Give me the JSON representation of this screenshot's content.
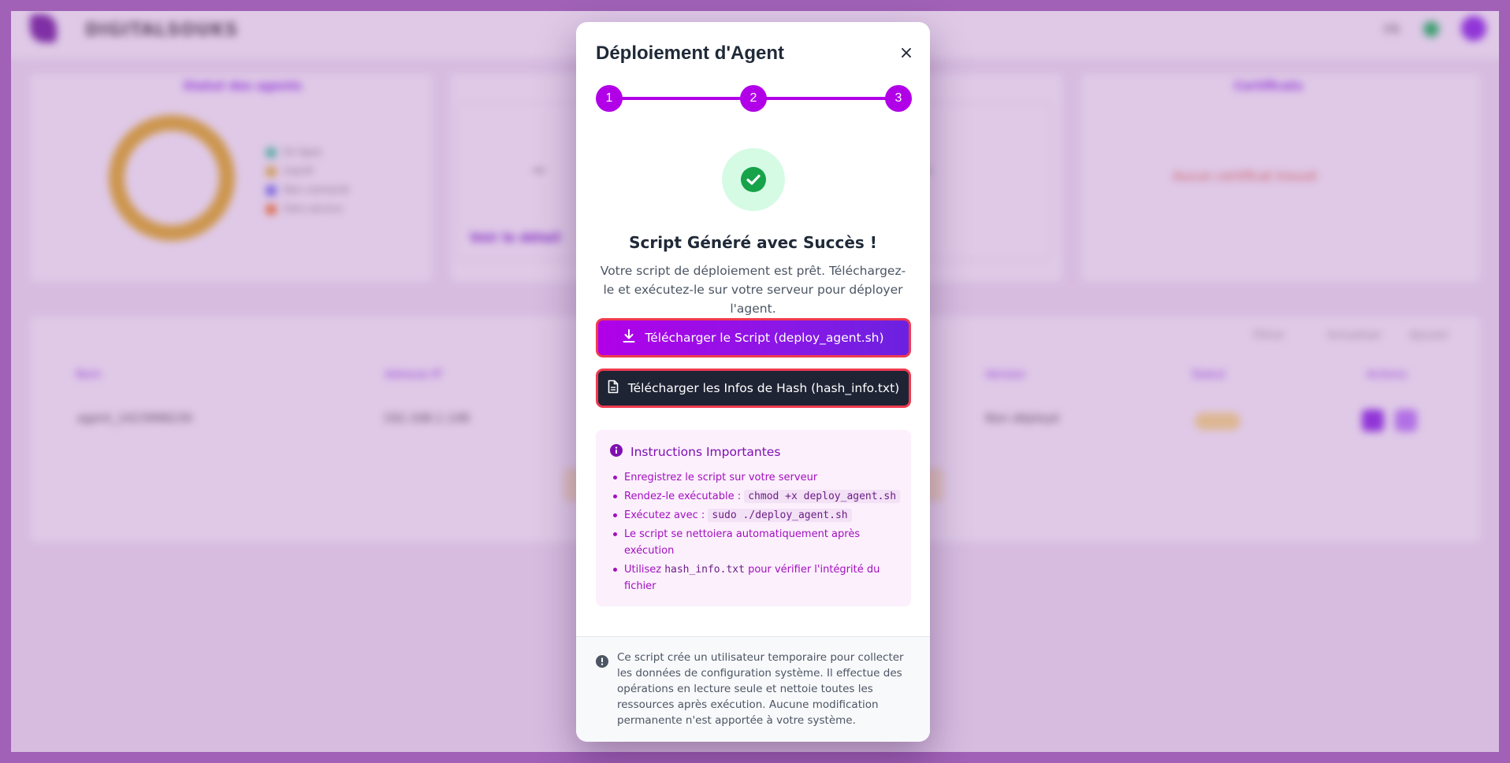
{
  "background": {
    "brand": "DIGITALSOUKS",
    "lang": "FR",
    "card1_title": "Statut des agents",
    "card3_title": "Certificats",
    "legend": [
      "En ligne",
      "Inactif",
      "Non connecté",
      "Hors service"
    ],
    "card3_message": "Aucun certificat trouvé",
    "link_text": "Voir le détail",
    "table_headers": [
      "Nom",
      "Adresse IP",
      "Version",
      "Statut",
      "Actions"
    ],
    "table_row": [
      "agent_1423998230",
      "192.168.1.148",
      "Non déployé"
    ],
    "toolbar": [
      "Filtrer",
      "Actualiser",
      "Ajouter"
    ]
  },
  "modal": {
    "title": "Déploiement d'Agent",
    "close_label": "×",
    "steps": [
      "1",
      "2",
      "3"
    ],
    "success_title": "Script Généré avec Succès !",
    "success_description": "Votre script de déploiement est prêt. Téléchargez-le et exécutez-le sur votre serveur pour déployer l'agent.",
    "download_script_label": "Télécharger le Script (deploy_agent.sh)",
    "download_hash_label": "Télécharger les Infos de Hash (hash_info.txt)",
    "instructions": {
      "title": "Instructions Importantes",
      "item1": "Enregistrez le script sur votre serveur",
      "item2_prefix": "Rendez-le exécutable : ",
      "item2_code": "chmod +x deploy_agent.sh",
      "item3_prefix": "Exécutez avec : ",
      "item3_code": "sudo ./deploy_agent.sh",
      "item4": "Le script se nettoiera automatiquement après exécution",
      "item5_prefix": "Utilisez ",
      "item5_code": "hash_info.txt",
      "item5_suffix": " pour vérifier l'intégrité du fichier"
    },
    "footer_note": "Ce script crée un utilisateur temporaire pour collecter les données de configuration système. Il effectue des opérations en lecture seule et nettoie toutes les ressources après exécution. Aucune modification permanente n'est apportée à votre système."
  },
  "colors": {
    "accent": "#b100e8",
    "success": "#16a34a",
    "dark_button": "#1f2435",
    "highlight_border": "#ef3b4f"
  },
  "icons": [
    "close-icon",
    "check-icon",
    "download-icon",
    "file-icon",
    "info-icon",
    "alert-icon"
  ]
}
